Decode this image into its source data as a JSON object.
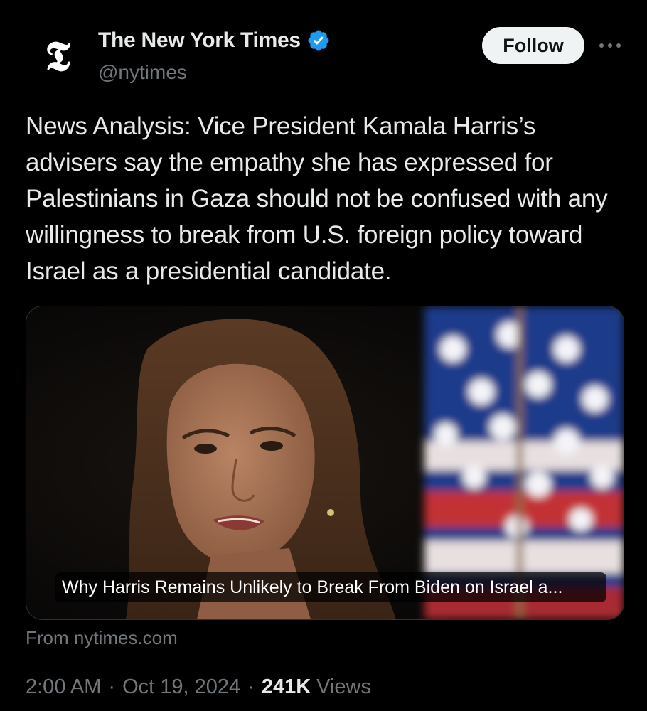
{
  "header": {
    "avatar_glyph": "𝕿",
    "display_name": "The New York Times",
    "handle": "@nytimes",
    "follow_label": "Follow",
    "verified_icon": "verified-badge-icon",
    "more_icon": "more-options-icon"
  },
  "tweet": {
    "text": "News Analysis: Vice President Kamala Harris’s advisers say the empathy she has expressed for Palestinians in Gaza should not be confused with any willingness to break from U.S. foreign policy toward Israel as a presidential candidate."
  },
  "card": {
    "caption": "Why Harris Remains Unlikely to Break From Biden on Israel a...",
    "source": "From nytimes.com"
  },
  "meta": {
    "time": "2:00 AM",
    "separator": "·",
    "date": "Oct 19, 2024",
    "views_count": "241K",
    "views_label": "Views"
  },
  "colors": {
    "background": "#000000",
    "primary_text": "#e7e9ea",
    "secondary_text": "#71767b",
    "verified_blue": "#1d9bf0",
    "follow_bg": "#eff3f4"
  }
}
